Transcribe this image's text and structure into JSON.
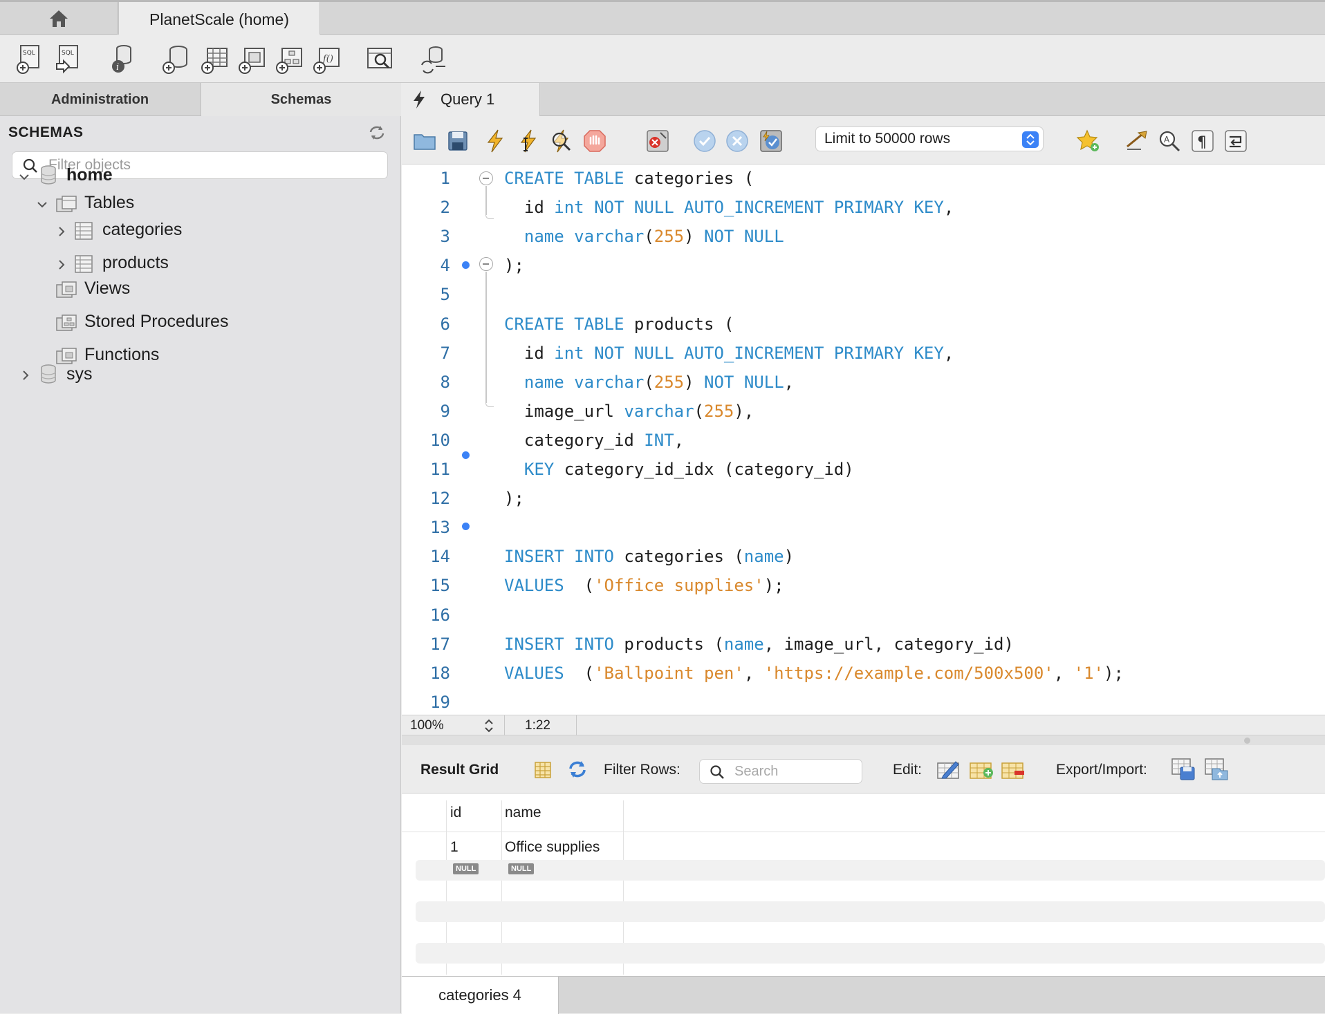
{
  "tabs": {
    "connection_tab": "PlanetScale (home)"
  },
  "sidebar": {
    "tabs": [
      "Administration",
      "Schemas"
    ],
    "header": "SCHEMAS",
    "filter_placeholder": "Filter objects",
    "tree": {
      "schema_home": "home",
      "tables": "Tables",
      "table_categories": "categories",
      "table_products": "products",
      "views": "Views",
      "stored_procedures": "Stored Procedures",
      "functions": "Functions",
      "schema_sys": "sys"
    }
  },
  "query_tab": {
    "label": "Query 1"
  },
  "editor_toolbar": {
    "limit_select": "Limit to 50000 rows"
  },
  "editor": {
    "line_numbers": [
      "1",
      "2",
      "3",
      "4",
      "5",
      "6",
      "7",
      "8",
      "9",
      "10",
      "11",
      "12",
      "13",
      "14",
      "15",
      "16",
      "17",
      "18",
      "19"
    ],
    "code_lines": [
      "CREATE TABLE categories (",
      "  id int NOT NULL AUTO_INCREMENT PRIMARY KEY,",
      "  name varchar(255) NOT NULL",
      ");",
      "",
      "CREATE TABLE products (",
      "  id int NOT NULL AUTO_INCREMENT PRIMARY KEY,",
      "  name varchar(255) NOT NULL,",
      "  image_url varchar(255),",
      "  category_id INT,",
      "  KEY category_id_idx (category_id)",
      ");",
      "",
      "INSERT INTO categories (name)",
      "VALUES  ('Office supplies');",
      "",
      "INSERT INTO products (name, image_url, category_id)",
      "VALUES  ('Ballpoint pen', 'https://example.com/500x500', '1');",
      ""
    ]
  },
  "status": {
    "zoom": "100%",
    "cursor": "1:22"
  },
  "result": {
    "title": "Result Grid",
    "filter_label": "Filter Rows:",
    "search_placeholder": "Search",
    "edit_label": "Edit:",
    "export_label": "Export/Import:",
    "columns": [
      "id",
      "name"
    ],
    "rows": [
      [
        "1",
        "Office supplies"
      ]
    ],
    "null_label": "NULL",
    "bottom_tab": "categories 4"
  },
  "colors": {
    "keyword": "#2d8bc9",
    "literal": "#d9882c",
    "accent": "#3b82f6"
  }
}
